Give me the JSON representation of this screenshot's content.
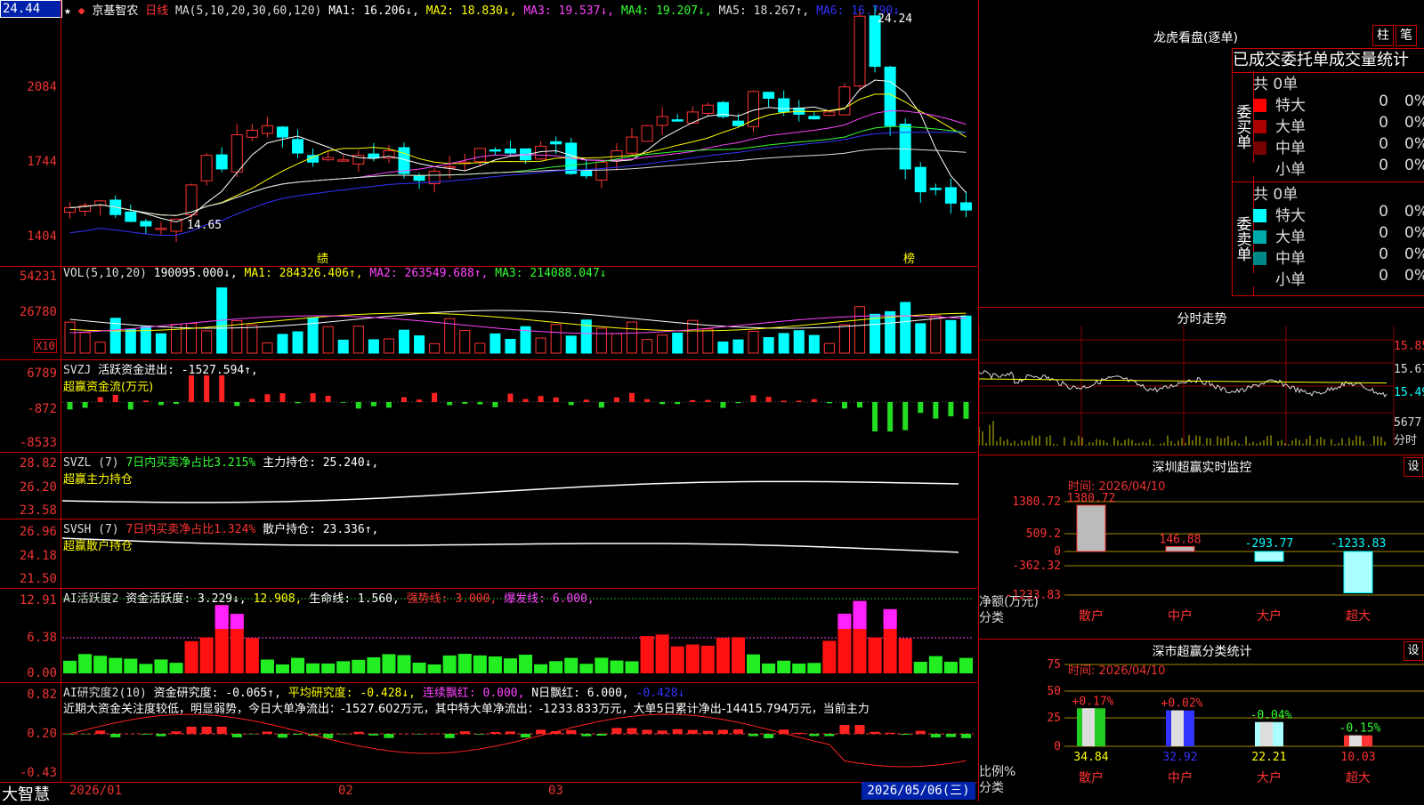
{
  "price_box": "24.44",
  "header": {
    "star": "★",
    "stock_name": "京基智农",
    "period": "日线",
    "ma_label": "MA(5,10,20,30,60,120)",
    "ma": [
      {
        "t": "MA1: 16.206↓",
        "c": "#ffffff"
      },
      {
        "t": "MA2: 18.830↓",
        "c": "#ffff00"
      },
      {
        "t": "MA3: 19.537↓",
        "c": "#ff44ff"
      },
      {
        "t": "MA4: 19.207↓",
        "c": "#33ff33"
      },
      {
        "t": "MA5: 18.267↑",
        "c": "#dddddd"
      },
      {
        "t": "MA6: 16.790↓",
        "c": "#3333ff"
      }
    ]
  },
  "main_y": [
    "2084",
    "1744",
    "1404"
  ],
  "main_labels": {
    "high": "24.24",
    "low": "14.65",
    "event1": "绩",
    "event2": "榜"
  },
  "vol": {
    "title": "VOL(5,10,20)",
    "val": "190095.000↓,",
    "ma1": "MA1: 284326.406↑,",
    "ma2": "MA2: 263549.688↑,",
    "ma3": "MA3: 214088.047↓",
    "y": [
      "54231",
      "26780"
    ],
    "unit": "X10"
  },
  "svzj": {
    "name": "SVZJ",
    "label": "活跃资金进出: -1527.594↑,",
    "sub": "超赢资金流(万元)",
    "y": [
      "6789",
      "-872",
      "-8533"
    ]
  },
  "svzl": {
    "name": "SVZL (7)",
    "pct": "7日内买卖净占比3.215%",
    "hold": "主力持仓: 25.240↓,",
    "sub": "超赢主力持仓",
    "y": [
      "28.82",
      "26.20",
      "23.58"
    ]
  },
  "svsh": {
    "name": "SVSH (7)",
    "pct": "7日内买卖净占比1.324%",
    "hold": "散户持仓: 23.336↑,",
    "sub": "超赢散户持仓",
    "y": [
      "26.96",
      "24.18",
      "21.50"
    ]
  },
  "ai1": {
    "name": "AI活跃度2",
    "a": "资金活跃度: 3.229↓,",
    "b": "12.908,",
    "c": "生命线: 1.560,",
    "d": "强势线: 3.000,",
    "e": "爆发线: 6.000,",
    "y": [
      "12.91",
      "6.38",
      "0.00"
    ]
  },
  "ai2": {
    "name": "AI研究度2(10)",
    "a": "资金研究度: -0.065↑,",
    "b": "平均研究度: -0.428↓,",
    "c": "连续飘红: 0.000,",
    "d": "N日飘红: 6.000,",
    "e": "-0.428↓",
    "text": "近期大资金关注度较低，明显弱势，今日大单净流出：-1527.602万元，其中特大单净流出：-1233.833万元，大单5日累计净出-14415.794万元，当前主力",
    "y": [
      "0.82",
      "0.20",
      "-0.43"
    ]
  },
  "footer": {
    "brand": "大智慧",
    "d1": "2026/01",
    "d2": "02",
    "d3": "03",
    "date": "2026/05/06(三)"
  },
  "lhb": {
    "title": "龙虎看盘(逐单)",
    "btn1": "柱",
    "btn2": "笔",
    "tabs": "已成交委托单成交量统计",
    "buy_label": "委买单",
    "sell_label": "委卖单",
    "buy": {
      "total": "共 0单",
      "rows": [
        {
          "name": "特大",
          "v": "0",
          "p": "0%",
          "c": "#ff0000"
        },
        {
          "name": "大单",
          "v": "0",
          "p": "0%",
          "c": "#aa0000"
        },
        {
          "name": "中单",
          "v": "0",
          "p": "0%",
          "c": "#770000"
        },
        {
          "name": "小单",
          "v": "0",
          "p": "0%",
          "c": "#000000"
        }
      ]
    },
    "sell": {
      "total": "共 0单",
      "rows": [
        {
          "name": "特大",
          "v": "0",
          "p": "0%",
          "c": "#00ffff"
        },
        {
          "name": "大单",
          "v": "0",
          "p": "0%",
          "c": "#00aaaa"
        },
        {
          "name": "中单",
          "v": "0",
          "p": "0%",
          "c": "#008888"
        },
        {
          "name": "小单",
          "v": "0",
          "p": "0%",
          "c": "#000000"
        }
      ]
    }
  },
  "fenshi": {
    "title": "分时走势",
    "y": [
      "15.85",
      "15.67",
      "15.49"
    ],
    "vol": "5677",
    "lab": "分时"
  },
  "sz_monitor": {
    "title": "深圳超赢实时监控",
    "btn": "设",
    "time": "时间: 2026/04/10",
    "y": [
      "1380.72",
      "509.2",
      "0",
      "-362.32",
      "-1233.83"
    ],
    "ylabel": "净额(万元)",
    "xlabel": "分类",
    "cats": [
      "散户",
      "中户",
      "大户",
      "超大"
    ],
    "vals": [
      "1380.72",
      "146.88",
      "-293.77",
      "-1233.83"
    ]
  },
  "sz_class": {
    "title": "深市超赢分类统计",
    "btn": "设",
    "time": "时间: 2026/04/10",
    "y": [
      "75",
      "50",
      "25",
      "0"
    ],
    "ylabel": "比例%",
    "xlabel": "分类",
    "cats": [
      "散户",
      "中户",
      "大户",
      "超大"
    ],
    "chg": [
      "+0.17%",
      "+0.02%",
      "-0.04%",
      "-0.15%"
    ],
    "vals": [
      "34.84",
      "32.92",
      "22.21",
      "10.03"
    ]
  }
}
